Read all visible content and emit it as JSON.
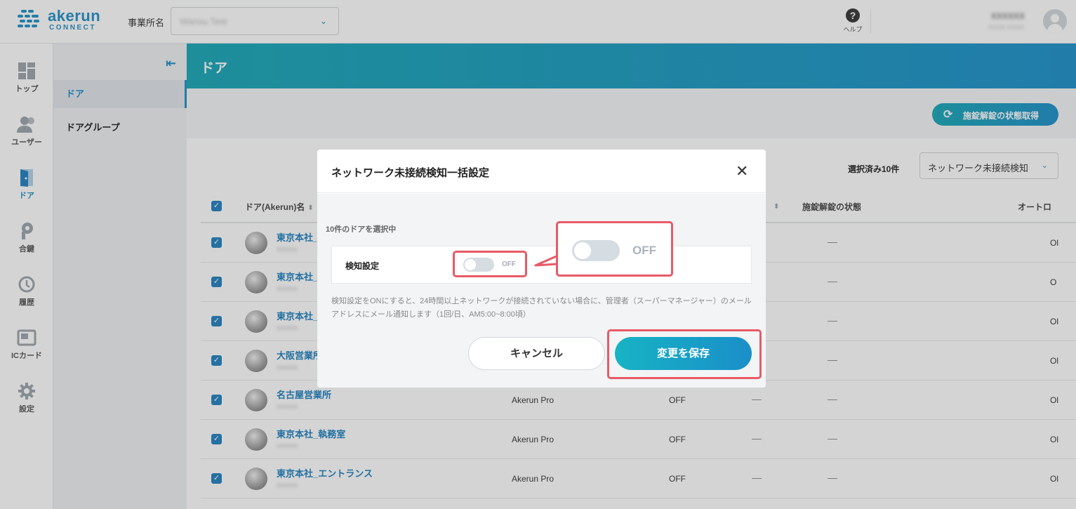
{
  "topbar": {
    "logo_text": "akerun",
    "logo_sub": "CONNECT",
    "office_label": "事業所名",
    "office_value": "Wansu Test",
    "help_label": "ヘルプ",
    "user_name": "XXXXXX",
    "user_sub": "XXXX XXXX"
  },
  "leftnav": [
    {
      "label": "トップ",
      "icon": "dashboard-icon"
    },
    {
      "label": "ユーザー",
      "icon": "users-icon"
    },
    {
      "label": "ドア",
      "icon": "door-icon"
    },
    {
      "label": "合鍵",
      "icon": "key-icon"
    },
    {
      "label": "履歴",
      "icon": "history-icon"
    },
    {
      "label": "ICカード",
      "icon": "ic-card-icon"
    },
    {
      "label": "設定",
      "icon": "gear-icon"
    }
  ],
  "subnav": {
    "items": [
      {
        "label": "ドア"
      },
      {
        "label": "ドアグループ"
      }
    ]
  },
  "main": {
    "title": "ドア",
    "fetch_button": "施錠解錠の状態取得",
    "selected_count": "選択済み10件",
    "bulk_action": "ネットワーク未接続検知",
    "columns": {
      "name": "ドア(Akerun)名",
      "lock_state": "施錠解錠の状態",
      "auto": "オートロ"
    },
    "rows": [
      {
        "name": "東京本社_",
        "sub": "xxxxxx",
        "model": "",
        "detect": "",
        "dash1": "",
        "dash2": "—",
        "auto": "Ol"
      },
      {
        "name": "東京本社_",
        "sub": "xxxxxx",
        "model": "",
        "detect": "",
        "dash1": "",
        "dash2": "—",
        "auto": "O"
      },
      {
        "name": "東京本社_",
        "sub": "xxxxxx",
        "model": "",
        "detect": "",
        "dash1": "",
        "dash2": "—",
        "auto": "Ol"
      },
      {
        "name": "大阪営業所",
        "sub": "xxxxxx",
        "model": "",
        "detect": "",
        "dash1": "",
        "dash2": "—",
        "auto": "Ol"
      },
      {
        "name": "名古屋営業所",
        "sub": "xxxxxx",
        "model": "Akerun Pro",
        "detect": "OFF",
        "dash1": "—",
        "dash2": "—",
        "auto": "Ol"
      },
      {
        "name": "東京本社_執務室",
        "sub": "xxxxxx",
        "model": "Akerun Pro",
        "detect": "OFF",
        "dash1": "—",
        "dash2": "—",
        "auto": "Ol"
      },
      {
        "name": "東京本社_エントランス",
        "sub": "xxxxxx",
        "model": "Akerun Pro",
        "detect": "OFF",
        "dash1": "—",
        "dash2": "—",
        "auto": "Ol"
      }
    ]
  },
  "modal": {
    "title": "ネットワーク未接続検知一括設定",
    "selected_info": "10件のドアを選択中",
    "setting_label": "検知設定",
    "toggle_state": "OFF",
    "note": "検知設定をONにすると、24時間以上ネットワークが接続されていない場合に、管理者（スーパーマネージャー）のメールアドレスにメール通知します（1回/日、AM5:00~8:00頃）",
    "cancel": "キャンセル",
    "save": "変更を保存"
  },
  "callout": {
    "toggle_state": "OFF"
  },
  "colors": {
    "accent": "#1f8fc6",
    "highlight": "#e85a65",
    "header_gradient_start": "#16a6b6"
  }
}
